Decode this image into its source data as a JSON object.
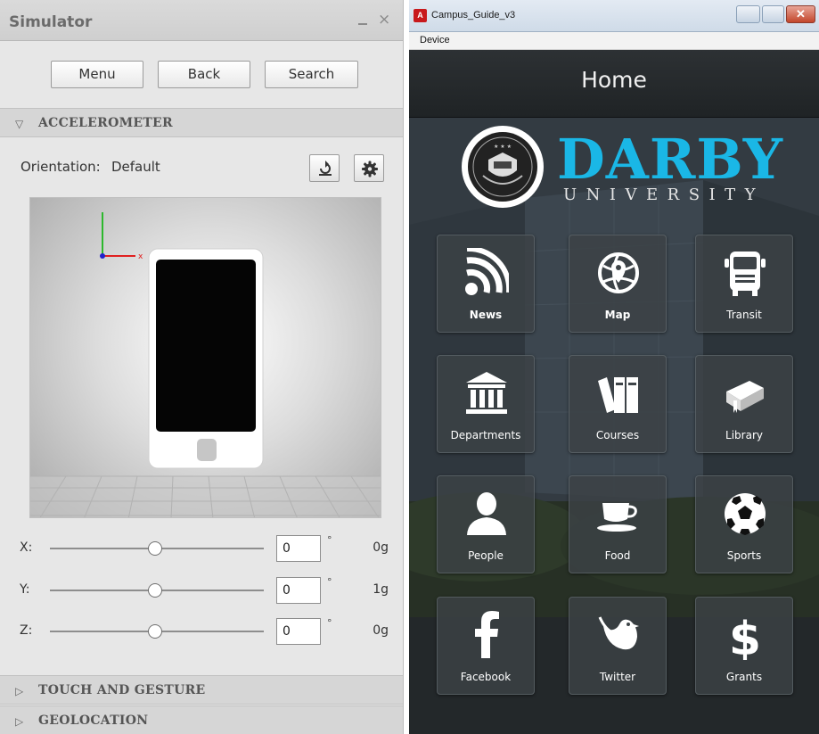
{
  "simulator": {
    "title": "Simulator",
    "buttons": {
      "menu": "Menu",
      "back": "Back",
      "search": "Search"
    },
    "accelerometer": {
      "heading": "ACCELEROMETER",
      "orientation_label": "Orientation:",
      "orientation_value": "Default",
      "axes": [
        {
          "label": "X:",
          "value": "0",
          "unit": "°",
          "g": "0g",
          "slider_fraction": 0.5
        },
        {
          "label": "Y:",
          "value": "0",
          "unit": "°",
          "g": "1g",
          "slider_fraction": 0.5
        },
        {
          "label": "Z:",
          "value": "0",
          "unit": "°",
          "g": "0g",
          "slider_fraction": 0.5
        }
      ],
      "gizmo_x_label": "x"
    },
    "sections": {
      "touch": "TOUCH AND GESTURE",
      "geolocation": "GEOLOCATION"
    }
  },
  "window": {
    "title": "Campus_Guide_v3",
    "app_icon_text": "A",
    "menu_device": "Device"
  },
  "app": {
    "header_title": "Home",
    "brand": {
      "name": "DARBY",
      "sub": "UNIVERSITY",
      "color": "#1ab7e6"
    },
    "tiles": [
      {
        "label": "News",
        "icon": "rss-icon",
        "bold": true
      },
      {
        "label": "Map",
        "icon": "globe-pin-icon",
        "bold": true
      },
      {
        "label": "Transit",
        "icon": "bus-icon",
        "bold": false
      },
      {
        "label": "Departments",
        "icon": "building-columns-icon",
        "bold": false
      },
      {
        "label": "Courses",
        "icon": "books-icon",
        "bold": false
      },
      {
        "label": "Library",
        "icon": "book-icon",
        "bold": false
      },
      {
        "label": "People",
        "icon": "person-icon",
        "bold": false
      },
      {
        "label": "Food",
        "icon": "coffee-cup-icon",
        "bold": false
      },
      {
        "label": "Sports",
        "icon": "soccer-ball-icon",
        "bold": false
      },
      {
        "label": "Facebook",
        "icon": "facebook-icon",
        "bold": false
      },
      {
        "label": "Twitter",
        "icon": "twitter-bird-icon",
        "bold": false
      },
      {
        "label": "Grants",
        "icon": "dollar-icon",
        "bold": false
      }
    ]
  }
}
